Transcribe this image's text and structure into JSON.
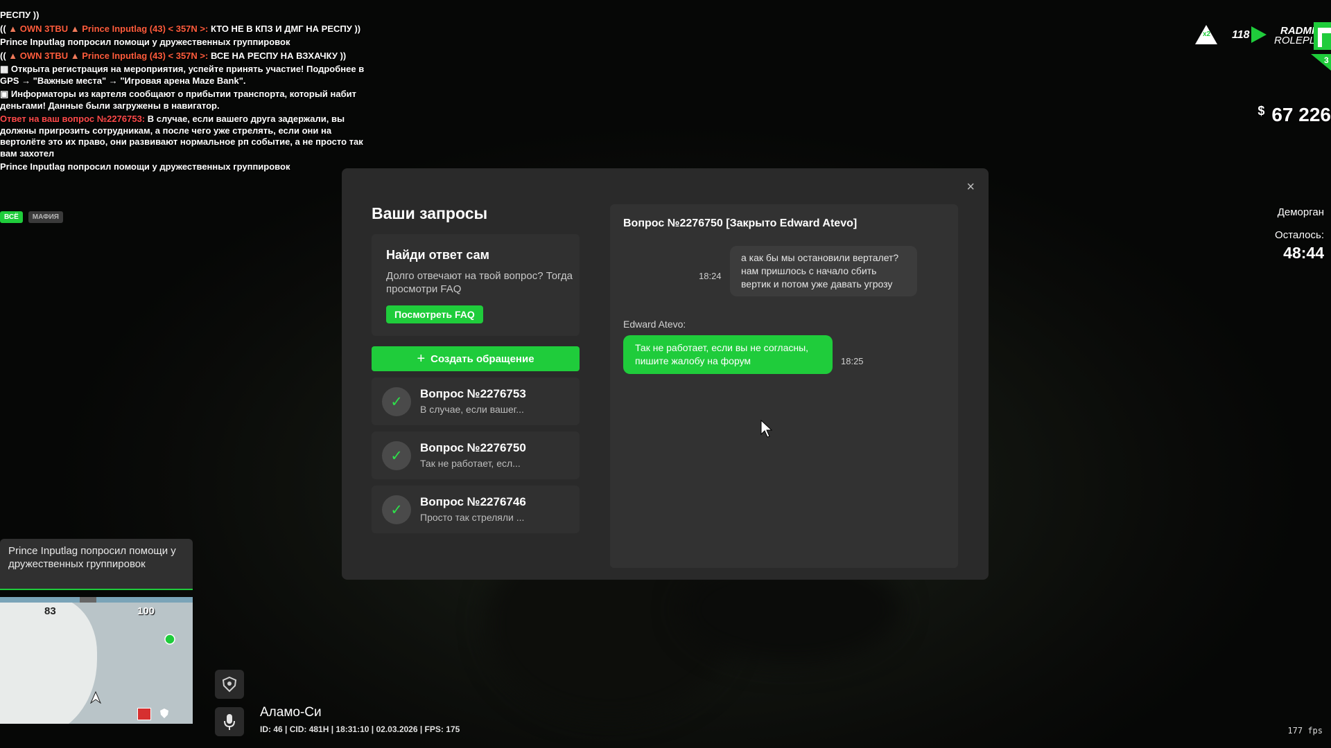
{
  "chat": [
    {
      "type": "plain",
      "text": "РЕСПУ ))"
    },
    {
      "type": "faction",
      "prefix": "((",
      "icon": "poop-icon",
      "tag": "OWN 3TBU",
      "icon2": "poop-icon",
      "name": "Prince Inputlag (43) < 357N >:",
      "text": "КТО НЕ В КПЗ И ДМГ НА РЕСПУ ))"
    },
    {
      "type": "plain",
      "text": "Prince Inputlag попросил помощи у дружественных группировок"
    },
    {
      "type": "faction",
      "prefix": "((",
      "icon": "poop-icon",
      "tag": "OWN 3TBU",
      "icon2": "poop-icon",
      "name": "Prince Inputlag (43) < 357N >:",
      "text": "ВСЕ НА РЕСПУ НА ВЗХАЧКУ ))"
    },
    {
      "type": "plain",
      "text": "▦ Открыта регистрация на мероприятия, успейте принять участие! Подробнее в GPS → \"Важные места\" → \"Игровая арена Maze Bank\"."
    },
    {
      "type": "plain",
      "text": "▣ Информаторы из картеля сообщают о прибытии транспорта, который набит деньгами! Данные были загружены в навигатор."
    },
    {
      "type": "answer",
      "label": "Ответ на ваш вопрос №2276753:",
      "text": "В случае, если вашего друга задержали, вы должны пригрозить сотрудникам, а после чего уже стрелять, если они на вертолёте это их право, они развивают нормальное рп событие, а не просто так вам захотел"
    },
    {
      "type": "plain",
      "text": "Prince Inputlag попросил помощи у дружественных группировок"
    }
  ],
  "chat_tabs": [
    "ВСЁ",
    "МАФИЯ"
  ],
  "hud": {
    "x2_badge": "x2",
    "online": "118",
    "logo_line1": "RADMIR",
    "logo_line2": "ROLEPLAY",
    "server_num": "3",
    "currency": "$",
    "money": "67 226",
    "quest_title": "Деморган",
    "remain_label": "Осталось:",
    "remain_time": "48:44"
  },
  "modal": {
    "title": "Ваши запросы",
    "close_glyph": "×",
    "faq_heading": "Найди ответ сам",
    "faq_text": "Долго отвечают на твой вопрос? Тогда просмотри FAQ",
    "faq_button": "Посмотреть FAQ",
    "create_plus": "+",
    "create_label": "Создать обращение",
    "requests": [
      {
        "title": "Вопрос №2276753",
        "snippet": "В случае, если вашег..."
      },
      {
        "title": "Вопрос №2276750",
        "snippet": "Так не работает, есл..."
      },
      {
        "title": "Вопрос №2276746",
        "snippet": "Просто так стреляли ..."
      }
    ],
    "conversation": {
      "title": "Вопрос №2276750 [Закрыто Edward Atevo]",
      "user_msg": "а как бы мы остановили верталет? нам пришлось с начало сбить вертик и потом уже давать угрозу",
      "user_time": "18:24",
      "admin_name": "Edward Atevo:",
      "admin_msg": "Так не работает, если вы не согласны, пишите жалобу на форум",
      "admin_time": "18:25"
    }
  },
  "notice": "Prince Inputlag попросил помощи у дружественных группировок",
  "map": {
    "label_a": "83",
    "label_b": "100"
  },
  "status": {
    "location": "Аламо-Си",
    "info": "ID: 46 | CID: 481Н | 18:31:10   | 02.03.2026 | FPS: 175",
    "fps_counter": "177 fps"
  },
  "colors": {
    "accent": "#1fcc3b",
    "panel": "#2a2a2a",
    "card": "#303030"
  }
}
